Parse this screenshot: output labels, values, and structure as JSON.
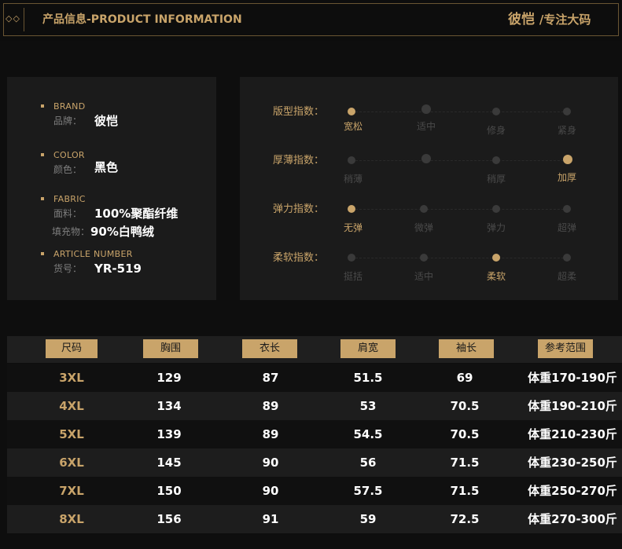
{
  "header": {
    "title": "产品信息-PRODUCT INFORMATION",
    "brand_main": "彼恺",
    "brand_sub": "/专注大码",
    "ornament": "◇◇"
  },
  "info": {
    "brand": {
      "en": "BRAND",
      "cn": "品牌：",
      "value": "彼恺"
    },
    "color": {
      "en": "COLOR",
      "cn": "颜色：",
      "value": "黑色"
    },
    "fabric": {
      "en": "FABRIC",
      "cn": "面料：",
      "value": "100%聚酯纤维",
      "cn2": "填充物：",
      "value2": "90%白鸭绒"
    },
    "article": {
      "en": "ARTICLE NUMBER",
      "cn": "货号：",
      "value": "YR-519"
    }
  },
  "indices": [
    {
      "label": "版型指数：",
      "options": [
        "宽松",
        "适中",
        "修身",
        "紧身"
      ],
      "selected": 0
    },
    {
      "label": "厚薄指数：",
      "options": [
        "稍薄",
        "",
        "稍厚",
        "加厚"
      ],
      "selected": 3
    },
    {
      "label": "弹力指数：",
      "options": [
        "无弹",
        "微弹",
        "弹力",
        "超弹"
      ],
      "selected": 0
    },
    {
      "label": "柔软指数：",
      "options": [
        "挺括",
        "适中",
        "柔软",
        "超柔"
      ],
      "selected": 2
    }
  ],
  "table": {
    "headers": [
      "尺码",
      "胸围",
      "衣长",
      "肩宽",
      "袖长",
      "参考范围"
    ],
    "rows": [
      [
        "3XL",
        "129",
        "87",
        "51.5",
        "69",
        "体重170-190斤"
      ],
      [
        "4XL",
        "134",
        "89",
        "53",
        "70.5",
        "体重190-210斤"
      ],
      [
        "5XL",
        "139",
        "89",
        "54.5",
        "70.5",
        "体重210-230斤"
      ],
      [
        "6XL",
        "145",
        "90",
        "56",
        "71.5",
        "体重230-250斤"
      ],
      [
        "7XL",
        "150",
        "90",
        "57.5",
        "71.5",
        "体重250-270斤"
      ],
      [
        "8XL",
        "156",
        "91",
        "59",
        "72.5",
        "体重270-300斤"
      ]
    ]
  },
  "colors": {
    "accent": "#c9a46a",
    "background": "#0e0e0e",
    "panel": "#1b1b1b"
  }
}
